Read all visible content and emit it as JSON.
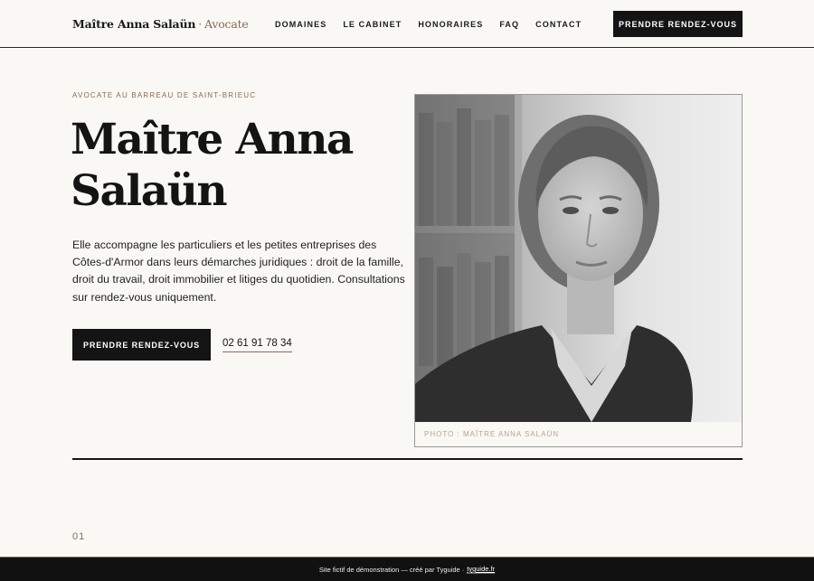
{
  "header": {
    "brand_name": "Maître Anna Salaün",
    "brand_separator": "·",
    "brand_role": "Avocate",
    "nav": [
      "DOMAINES",
      "LE CABINET",
      "HONORAIRES",
      "FAQ",
      "CONTACT"
    ],
    "cta_label": "PRENDRE RENDEZ-VOUS"
  },
  "hero": {
    "eyebrow": "AVOCATE AU BARREAU DE SAINT-BRIEUC",
    "title_line1": "Maître Anna",
    "title_line2": "Salaün",
    "text": "Elle accompagne les particuliers et les petites entreprises des Côtes-d'Armor dans leurs démarches juridiques : droit de la famille, droit du travail, droit immobilier et litiges du quotidien. Consultations sur rendez-vous uniquement.",
    "cta_label": "PRENDRE RENDEZ-VOUS",
    "phone": "02 61 91 78 34"
  },
  "portrait": {
    "caption": "PHOTO : MAÎTRE ANNA SALAÜN"
  },
  "section": {
    "number": "01"
  },
  "footer": {
    "text": "Site fictif de démonstration — créé par Tyguide ·",
    "link": "tyguide.fr"
  },
  "colors": {
    "background": "#f9f8f4",
    "accent": "#8a6a55",
    "dark": "#141414"
  }
}
